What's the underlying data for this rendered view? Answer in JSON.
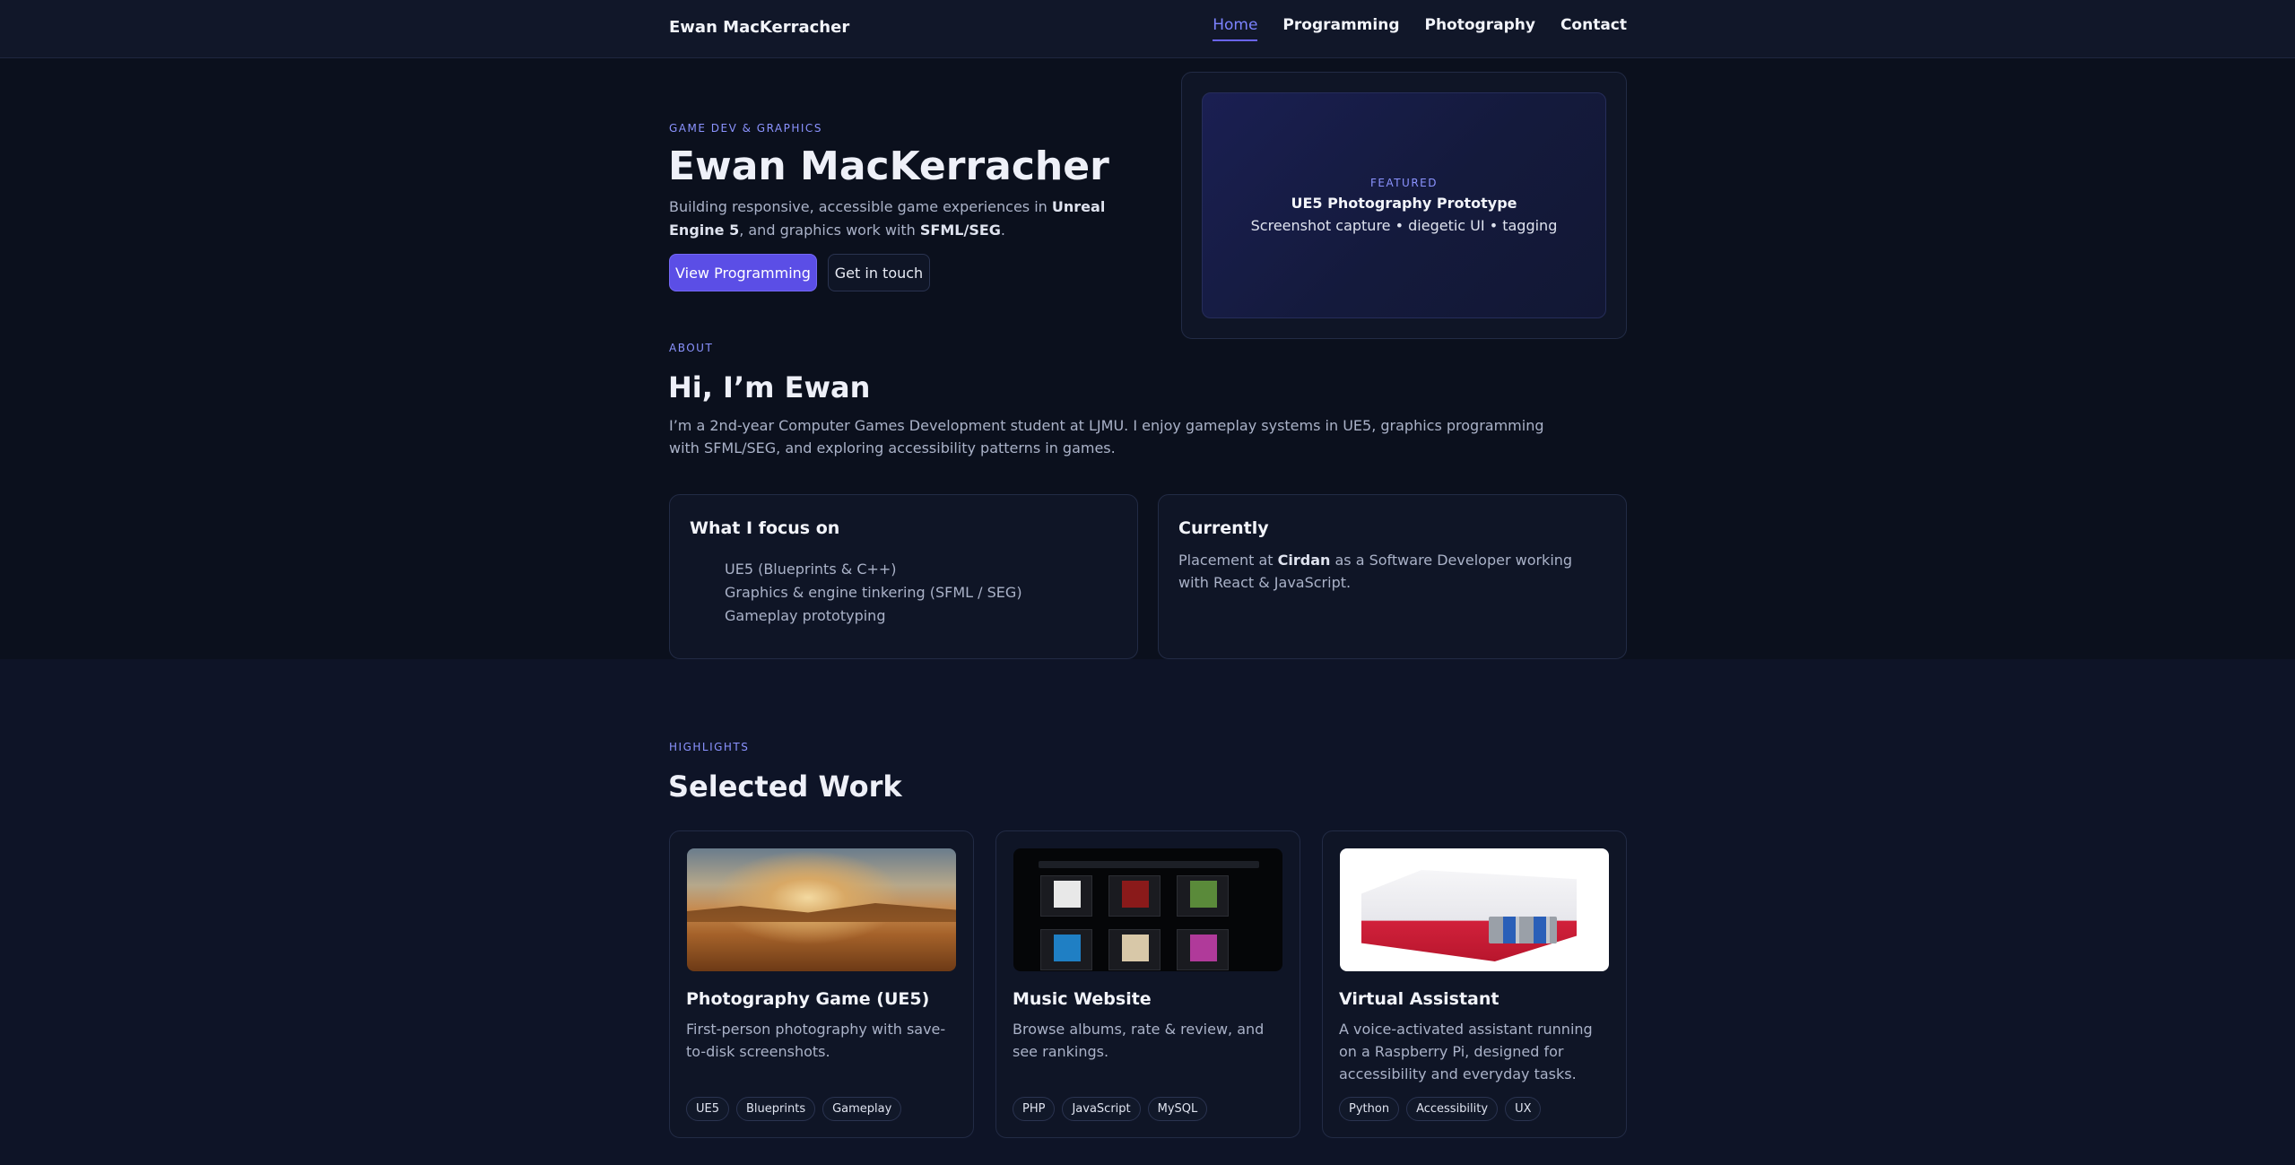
{
  "nav": {
    "brand": "Ewan MacKerracher",
    "links": [
      "Home",
      "Programming",
      "Photography",
      "Contact"
    ]
  },
  "hero": {
    "eyebrow": "GAME DEV & GRAPHICS",
    "title": "Ewan MacKerracher",
    "lead_1": "Building responsive, accessible game experiences in ",
    "lead_bold_1": "Unreal Engine 5",
    "lead_2": ", and graphics work with ",
    "lead_bold_2": "SFML/SEG",
    "lead_3": ".",
    "primary_button": "View Programming",
    "secondary_button": "Get in touch"
  },
  "featured": {
    "eyebrow": "FEATURED",
    "title": "UE5 Photography Prototype",
    "subtitle": "Screenshot capture • diegetic UI • tagging"
  },
  "about": {
    "eyebrow": "ABOUT",
    "title": "Hi, I’m Ewan",
    "text": "I’m a 2nd-year Computer Games Development student at LJMU. I enjoy gameplay systems in UE5, graphics programming with SFML/SEG, and exploring accessibility patterns in games."
  },
  "focus": {
    "title": "What I focus on",
    "items": [
      "UE5 (Blueprints & C++)",
      "Graphics & engine tinkering (SFML / SEG)",
      "Gameplay prototyping"
    ]
  },
  "currently": {
    "title": "Currently",
    "text_1": "Placement at ",
    "text_bold": "Cirdan",
    "text_2": " as a Software Developer working with React & JavaScript."
  },
  "highlights": {
    "eyebrow": "HIGHLIGHTS",
    "title": "Selected Work",
    "cards": [
      {
        "title": "Photography Game (UE5)",
        "desc": "First-person photography with save-to-disk screenshots.",
        "tags": [
          "UE5",
          "Blueprints",
          "Gameplay"
        ]
      },
      {
        "title": "Music Website",
        "desc": "Browse albums, rate & review, and see rankings.",
        "tags": [
          "PHP",
          "JavaScript",
          "MySQL"
        ]
      },
      {
        "title": "Virtual Assistant",
        "desc": "A voice-activated assistant running on a Raspberry Pi, designed for accessibility and everyday tasks.",
        "tags": [
          "Python",
          "Accessibility",
          "UX"
        ]
      }
    ]
  },
  "colors": {
    "accent": "#5b4ee6",
    "accent_text": "#8b93ff",
    "background": "#0c1120",
    "card": "#0f1526"
  }
}
